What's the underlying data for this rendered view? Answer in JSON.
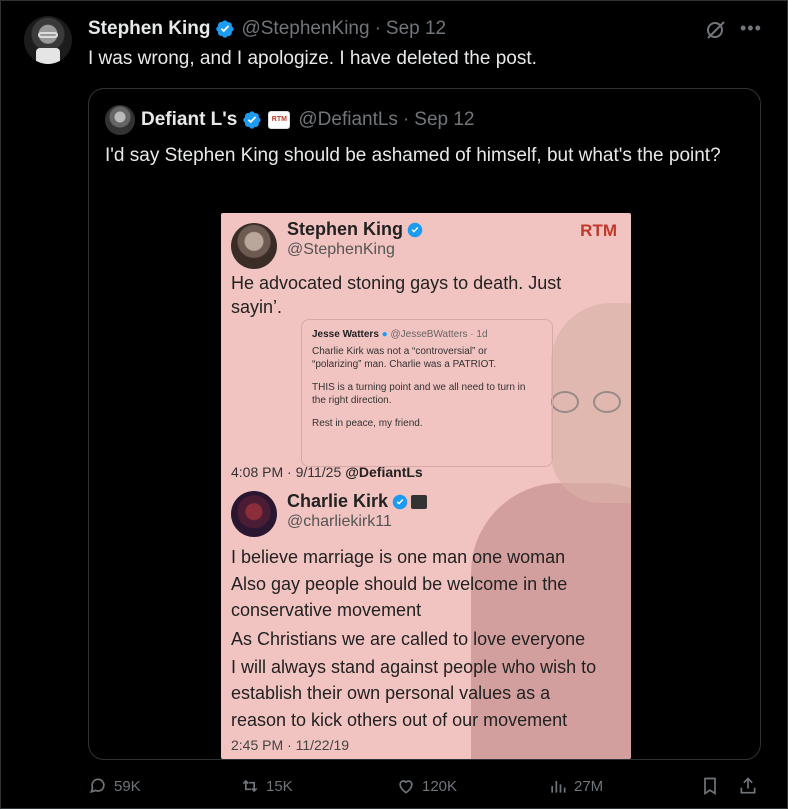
{
  "post": {
    "author_name": "Stephen King",
    "author_handle": "@StephenKing",
    "date": "Sep 12",
    "text": "I was wrong, and I apologize. I have deleted the post."
  },
  "quoted": {
    "author_name": "Defiant L's",
    "badge_text": "RTM",
    "author_handle": "@DefiantLs",
    "date": "Sep 12",
    "text": "I'd say Stephen King should be ashamed of himself, but what's the point?"
  },
  "media": {
    "brand": "RTM",
    "top_name": "Stephen King",
    "top_handle": "@StephenKing",
    "top_text_1": "He advocated stoning gays to death. Just",
    "top_text_2": "sayin’.",
    "inner_name": "Jesse Watters",
    "inner_handle": "@JesseBWatters · 1d",
    "inner_line1": "Charlie Kirk was not a “controversial” or",
    "inner_line2": "“polarizing” man. Charlie was a PATRIOT.",
    "inner_line3": "THIS is a turning point and we all need to turn in",
    "inner_line4": "the right direction.",
    "inner_line5": "Rest in peace, my friend.",
    "stamp_time": "4:08 PM · 9/11/25",
    "stamp_tag": "@DefiantLs",
    "ck_name": "Charlie Kirk",
    "ck_handle": "@charliekirk11",
    "ck_lines": [
      "I believe marriage is one man one woman",
      "Also gay people should be welcome in the",
      "conservative movement",
      "As Christians we are called to love everyone",
      "I will always stand against people who wish to",
      "establish their own personal values as a",
      "reason to kick others out of our movement"
    ],
    "ck_date": "2:45 PM · 11/22/19"
  },
  "actions": {
    "replies": "59K",
    "reposts": "15K",
    "likes": "120K",
    "views": "27M"
  },
  "colors": {
    "verified": "#1d9bf0",
    "muted": "#71767b",
    "media_bg": "#f1c3c1",
    "brand_red": "#c0392b"
  }
}
